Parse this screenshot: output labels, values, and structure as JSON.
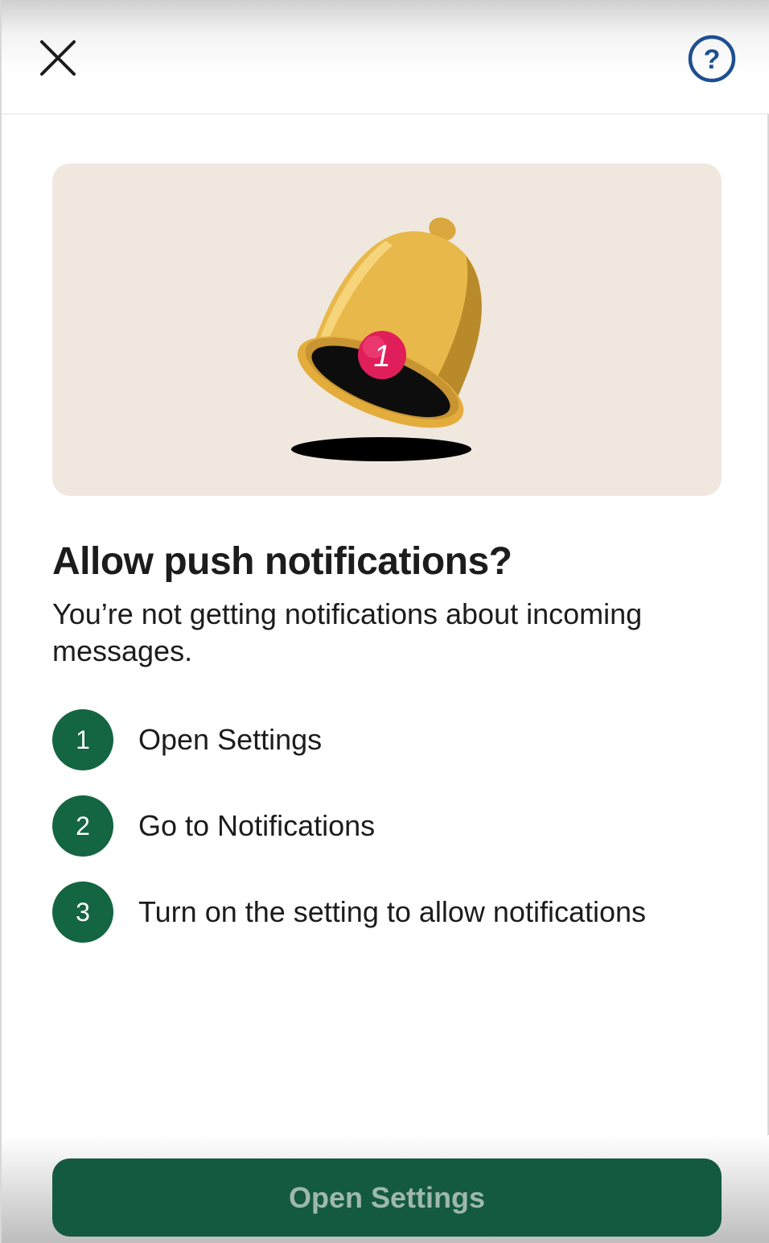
{
  "header": {
    "close_icon": "close-icon",
    "help_icon": "help-icon",
    "help_glyph": "?"
  },
  "hero": {
    "illustration": "bell-icon",
    "badge_count": "1"
  },
  "content": {
    "title": "Allow push notifications?",
    "subtitle": "You’re not getting notifications about incoming messages.",
    "steps": [
      {
        "number": "1",
        "text": "Open Settings"
      },
      {
        "number": "2",
        "text": "Go to Notifications"
      },
      {
        "number": "3",
        "text": "Turn on the setting to allow notifications"
      }
    ]
  },
  "footer": {
    "cta_label": "Open Settings"
  },
  "colors": {
    "accent_green": "#146542",
    "help_blue": "#1d4f91",
    "hero_bg": "#f0e8df",
    "bell_gold": "#e8b84a",
    "badge_red": "#e01e5a"
  }
}
